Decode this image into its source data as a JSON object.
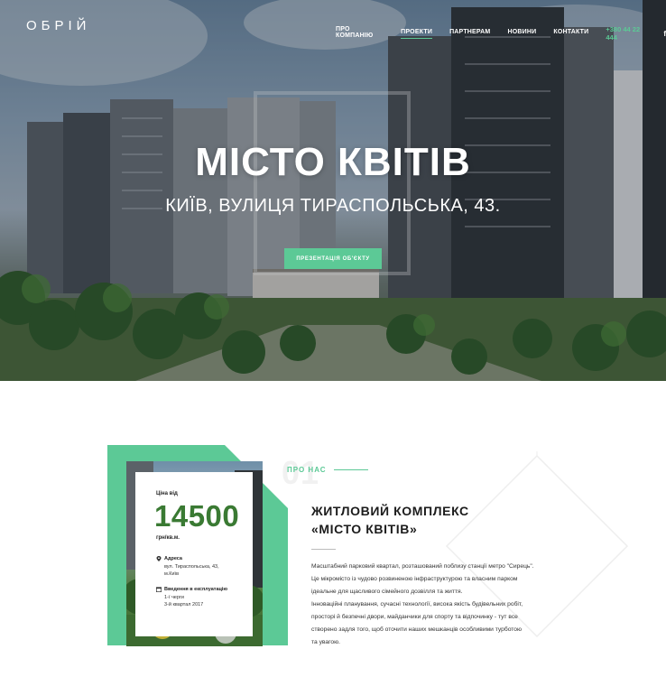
{
  "header": {
    "logo": "ОБРІЙ",
    "nav": [
      {
        "label": "ПРО КОМПАНІЮ",
        "active": false
      },
      {
        "label": "ПРОЕКТИ",
        "active": true
      },
      {
        "label": "ПАРТНЕРАМ",
        "active": false
      },
      {
        "label": "НОВИНИ",
        "active": false
      },
      {
        "label": "КОНТАКТИ",
        "active": false
      }
    ],
    "phone": "+380 44 22 444",
    "social_icon": "facebook-icon",
    "social_label": "f"
  },
  "hero": {
    "title": "МІСТО КВІТІВ",
    "subtitle": "КИЇВ, ВУЛИЦЯ ТИРАСПОЛЬСЬКА, 43.",
    "button_label": "ПРЕЗЕНТАЦІЯ ОБ'ЄКТУ"
  },
  "about": {
    "section_number": "01",
    "section_label": "ПРО НАС",
    "title_line1": "ЖИТЛОВИЙ КОМПЛЕКС",
    "title_line2": "«МІСТО КВІТІВ»",
    "paragraphs": [
      "Масштабний парковий квартал, розташований поблизу станції метро \"Сирець\".",
      "Це мікромісто із чудово розвиненою інфраструктурою та власним парком",
      "ідеальне для щасливого сімейного дозвілля та життя.",
      "Інноваційні планування, сучасні технології, висока якість будівельних робіт,",
      "просторі й безпечні двори, майданчики для спорту та відпочинку - тут все",
      "створено задля того, щоб оточити наших мешканців особливими турботою",
      "та увагою."
    ]
  },
  "card": {
    "price_label": "Ціна від",
    "price": "14500",
    "price_unit": "грн/кв.м.",
    "address_icon": "location-pin-icon",
    "address_heading": "Адреса",
    "address_line1": "вул. Тираспольська, 43,",
    "address_line2": "м.Київ",
    "date_icon": "calendar-icon",
    "date_heading": "Введення в експлуатацію",
    "date_line1": "1-ї черги",
    "date_line2": "3-й квартал 2017"
  },
  "colors": {
    "accent": "#5cc996",
    "price": "#3a7a33",
    "text": "#1c1c1c"
  }
}
